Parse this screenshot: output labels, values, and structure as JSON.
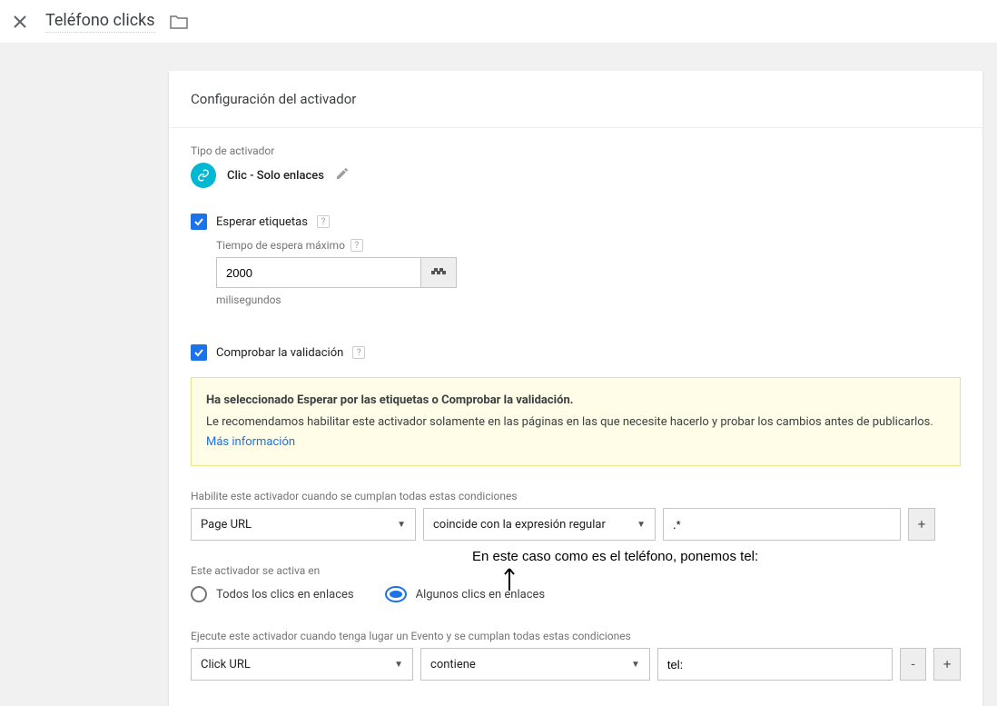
{
  "header": {
    "title": "Teléfono clicks"
  },
  "card": {
    "title": "Configuración del activador",
    "typeLabel": "Tipo de activador",
    "typeName": "Clic - Solo enlaces",
    "waitTags": "Esperar etiquetas",
    "maxWaitLabel": "Tiempo de espera máximo",
    "maxWaitValue": "2000",
    "maxWaitUnit": "milisegundos",
    "checkValidation": "Comprobar la validación",
    "noticeBold": "Ha seleccionado Esperar por las etiquetas o Comprobar la validación.",
    "noticeText": "Le recomendamos habilitar este activador solamente en las páginas en las que necesite hacerlo y probar los cambios antes de publicarlos. ",
    "noticeLink": "Más información",
    "enableLabel": "Habilite este activador cuando se cumplan todas estas condiciones",
    "cond1": {
      "var": "Page URL",
      "op": "coincide con la expresión regular",
      "val": ".*",
      "plus": "+"
    },
    "firesOnLabel": "Este activador se activa en",
    "radioAll": "Todos los clics en enlaces",
    "radioSome": "Algunos clics en enlaces",
    "fireCondLabel": "Ejecute este activador cuando tenga lugar un Evento y se cumplan todas estas condiciones",
    "cond2": {
      "var": "Click URL",
      "op": "contiene",
      "val": "tel:",
      "minus": "-",
      "plus": "+"
    }
  },
  "annotation": "En este caso como es el teléfono, ponemos tel:"
}
